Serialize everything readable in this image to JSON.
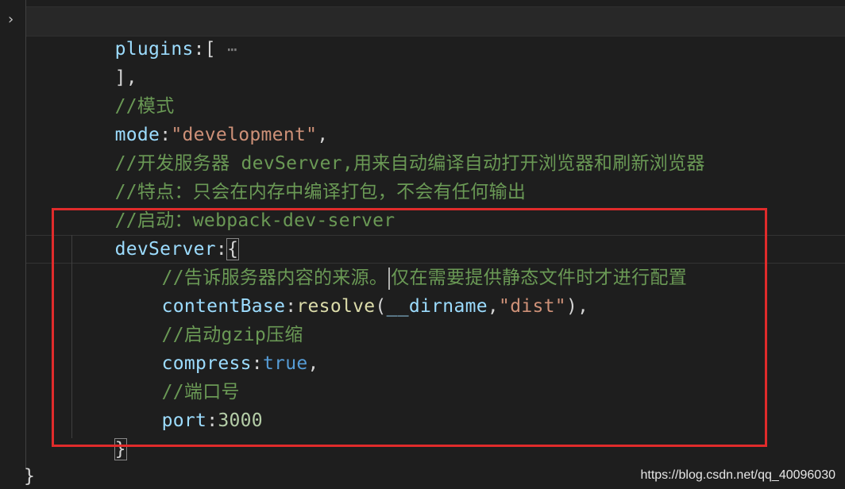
{
  "editor": {
    "lines": {
      "plugins_key": "plugins",
      "plugins_open": ":[",
      "plugins_fold": "⋯",
      "plugins_close": "],",
      "comment_mode": "//模式",
      "mode_key": "mode",
      "mode_colon": ":",
      "mode_value": "\"development\"",
      "mode_comma": ",",
      "comment_devserver": "//开发服务器 devServer,用来自动编译自动打开浏览器和刷新浏览器",
      "comment_feature": "//特点：只会在内存中编译打包，不会有任何输出",
      "comment_start": "//启动：webpack-dev-server",
      "devserver_key": "devServer",
      "devserver_colon": ":",
      "devserver_open": "{",
      "comment_source_a": "//告诉服务器内容的来源。",
      "comment_source_b": "仅在需要提供静态文件时才进行配置",
      "contentbase_key": "contentBase",
      "contentbase_colon": ":",
      "resolve_fn": "resolve",
      "resolve_open": "(",
      "dirname_var": "__dirname",
      "resolve_comma": ",",
      "dist_str": "\"dist\"",
      "resolve_close": "),",
      "comment_gzip": "//启动gzip压缩",
      "compress_key": "compress",
      "compress_colon": ":",
      "compress_value": "true",
      "compress_comma": ",",
      "comment_port": "//端口号",
      "port_key": "port",
      "port_colon": ":",
      "port_value": "3000",
      "devserver_close": "}",
      "outer_close": "}"
    },
    "fold_arrow": "›"
  },
  "watermark": "https://blog.csdn.net/qq_40096030",
  "colors": {
    "background": "#1e1e1e",
    "property": "#9cdcfe",
    "string": "#ce9178",
    "comment": "#6a9955",
    "function": "#dcdcaa",
    "boolean": "#569cd6",
    "number": "#b5cea8",
    "highlight_box": "#e02b2b"
  }
}
